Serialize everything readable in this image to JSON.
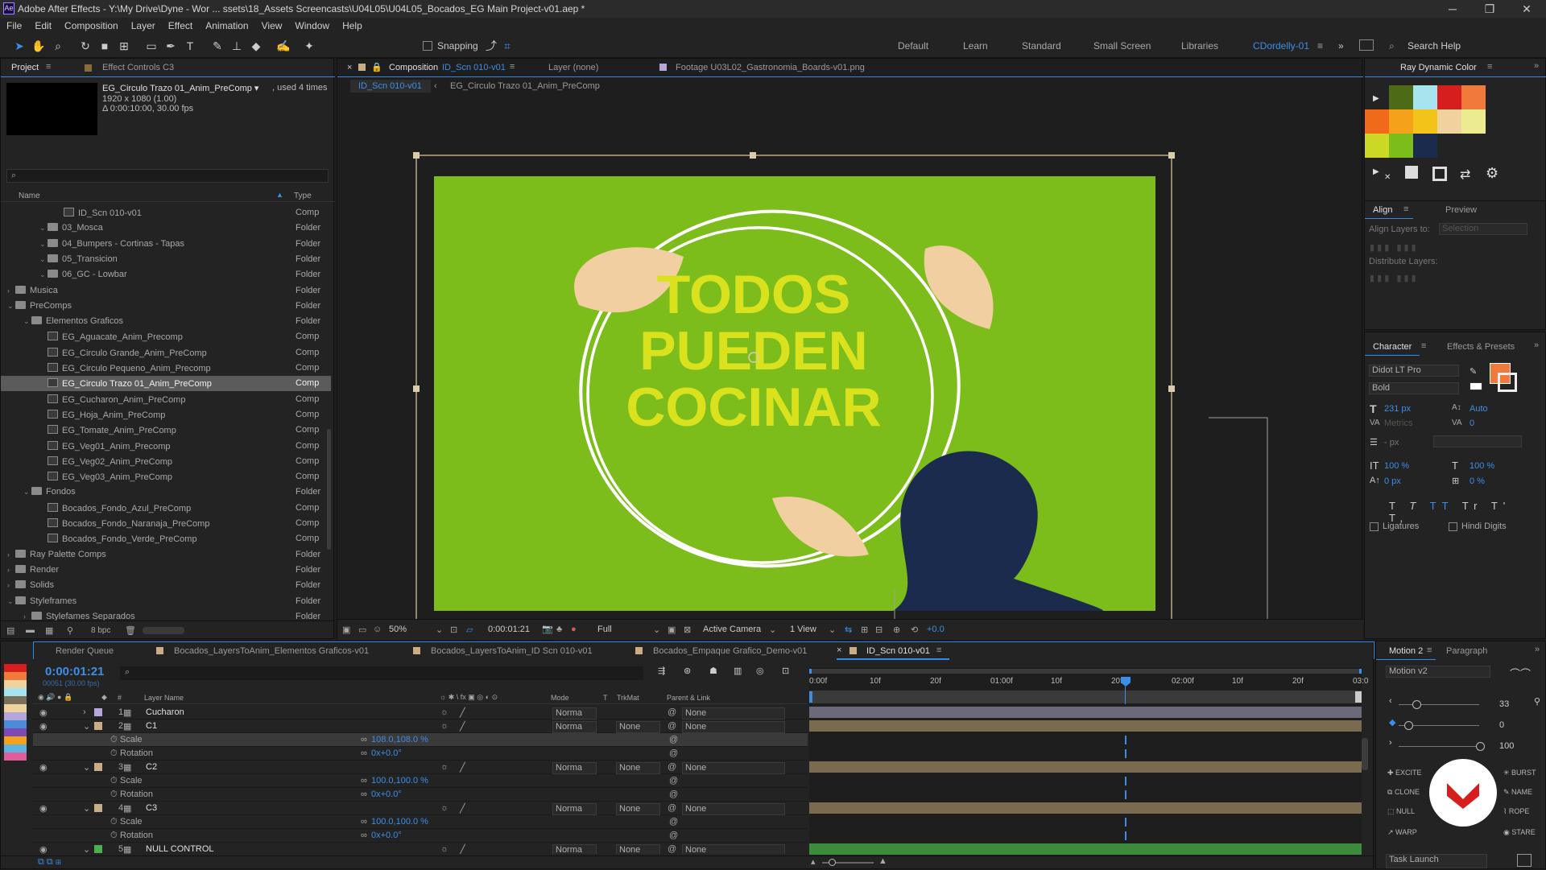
{
  "window": {
    "title": "Adobe After Effects - Y:\\My Drive\\Dyne - Wor ... ssets\\18_Assets Screencasts\\U04L05\\U04L05_Bocados_EG Main Project-v01.aep *"
  },
  "menu": [
    "File",
    "Edit",
    "Composition",
    "Layer",
    "Effect",
    "Animation",
    "View",
    "Window",
    "Help"
  ],
  "toolbar": {
    "snapping": "Snapping",
    "workspaces": [
      "Default",
      "Learn",
      "Standard",
      "Small Screen",
      "Libraries",
      "CDordelly-01"
    ],
    "search_help": "Search Help"
  },
  "project": {
    "tab": "Project",
    "tab2": "Effect Controls C3",
    "item_name": "EG_Circulo Trazo 01_Anim_PreComp ▾",
    "used": ", used 4 times",
    "info1": "1920 x 1080 (1.00)",
    "info2": "Δ 0:00:10:00, 30.00 fps",
    "col_name": "Name",
    "col_type": "Type",
    "bpc": "8 bpc",
    "rows": [
      {
        "name": "ID_Scn 010-v01",
        "type": "Comp",
        "indent": 3,
        "kind": "comp",
        "tri": ""
      },
      {
        "name": "03_Mosca",
        "type": "Folder",
        "indent": 2,
        "kind": "folder",
        "tri": "v"
      },
      {
        "name": "04_Bumpers - Cortinas - Tapas",
        "type": "Folder",
        "indent": 2,
        "kind": "folder",
        "tri": "v"
      },
      {
        "name": "05_Transicion",
        "type": "Folder",
        "indent": 2,
        "kind": "folder",
        "tri": "v"
      },
      {
        "name": "06_GC - Lowbar",
        "type": "Folder",
        "indent": 2,
        "kind": "folder",
        "tri": "v"
      },
      {
        "name": "Musica",
        "type": "Folder",
        "indent": 0,
        "kind": "folder",
        "tri": ">"
      },
      {
        "name": "PreComps",
        "type": "Folder",
        "indent": 0,
        "kind": "folder",
        "tri": "v"
      },
      {
        "name": "Elementos Graficos",
        "type": "Folder",
        "indent": 1,
        "kind": "folder",
        "tri": "v"
      },
      {
        "name": "EG_Aguacate_Anim_Precomp",
        "type": "Comp",
        "indent": 2,
        "kind": "comp",
        "tri": ""
      },
      {
        "name": "EG_Circulo Grande_Anim_PreComp",
        "type": "Comp",
        "indent": 2,
        "kind": "comp",
        "tri": ""
      },
      {
        "name": "EG_Circulo Pequeno_Anim_Precomp",
        "type": "Comp",
        "indent": 2,
        "kind": "comp",
        "tri": ""
      },
      {
        "name": "EG_Circulo Trazo 01_Anim_PreComp",
        "type": "Comp",
        "indent": 2,
        "kind": "comp",
        "tri": "",
        "sel": true
      },
      {
        "name": "EG_Cucharon_Anim_PreComp",
        "type": "Comp",
        "indent": 2,
        "kind": "comp",
        "tri": ""
      },
      {
        "name": "EG_Hoja_Anim_PreComp",
        "type": "Comp",
        "indent": 2,
        "kind": "comp",
        "tri": ""
      },
      {
        "name": "EG_Tomate_Anim_PreComp",
        "type": "Comp",
        "indent": 2,
        "kind": "comp",
        "tri": ""
      },
      {
        "name": "EG_Veg01_Anim_Precomp",
        "type": "Comp",
        "indent": 2,
        "kind": "comp",
        "tri": ""
      },
      {
        "name": "EG_Veg02_Anim_PreComp",
        "type": "Comp",
        "indent": 2,
        "kind": "comp",
        "tri": ""
      },
      {
        "name": "EG_Veg03_Anim_PreComp",
        "type": "Comp",
        "indent": 2,
        "kind": "comp",
        "tri": ""
      },
      {
        "name": "Fondos",
        "type": "Folder",
        "indent": 1,
        "kind": "folder",
        "tri": "v"
      },
      {
        "name": "Bocados_Fondo_Azul_PreComp",
        "type": "Comp",
        "indent": 2,
        "kind": "comp",
        "tri": ""
      },
      {
        "name": "Bocados_Fondo_Naranaja_PreComp",
        "type": "Comp",
        "indent": 2,
        "kind": "comp",
        "tri": ""
      },
      {
        "name": "Bocados_Fondo_Verde_PreComp",
        "type": "Comp",
        "indent": 2,
        "kind": "comp",
        "tri": ""
      },
      {
        "name": "Ray Palette Comps",
        "type": "Folder",
        "indent": 0,
        "kind": "folder",
        "tri": ">"
      },
      {
        "name": "Render",
        "type": "Folder",
        "indent": 0,
        "kind": "folder",
        "tri": ">"
      },
      {
        "name": "Solids",
        "type": "Folder",
        "indent": 0,
        "kind": "folder",
        "tri": ">"
      },
      {
        "name": "Styleframes",
        "type": "Folder",
        "indent": 0,
        "kind": "folder",
        "tri": "v"
      },
      {
        "name": "Stylefames Separados",
        "type": "Folder",
        "indent": 1,
        "kind": "folder",
        "tri": ">"
      }
    ]
  },
  "viewer": {
    "tab_comp_prefix": "Composition ",
    "tab_comp_name": "ID_Scn 010-v01",
    "tab_layer": "Layer (none)",
    "tab_footage": "Footage  U03L02_Gastronomia_Boards-v01.png",
    "crumb1": "ID_Scn 010-v01",
    "crumb2": "EG_Circulo Trazo 01_Anim_PreComp",
    "headline": [
      "TODOS",
      "PUEDEN",
      "COCINAR"
    ],
    "zoom": "50%",
    "timecode": "0:00:01:21",
    "resolution": "Full",
    "camera": "Active Camera",
    "views": "1 View",
    "exposure": "+0.0",
    "bg_color": "#7cbd1c",
    "text_color": "#d9e21c",
    "leaf_color": "#f1cfa0",
    "spoon_color": "#1a2b4e"
  },
  "timeline": {
    "tabs": [
      "Render Queue",
      "Bocados_LayersToAnim_Elementos Graficos-v01",
      "Bocados_LayersToAnim_ID Scn 010-v01",
      "Bocados_Empaque Grafico_Demo-v01",
      "ID_Scn 010-v01"
    ],
    "timecode": "0:00:01:21",
    "frames": "00051 (30.00 fps)",
    "headers": {
      "num": "#",
      "layer": "Layer Name",
      "mode": "Mode",
      "t": "T",
      "trkmat": "TrkMat",
      "parent": "Parent & Link"
    },
    "ruler": [
      "0:00f",
      "10f",
      "20f",
      "01:00f",
      "10f",
      "20f",
      "02:00f",
      "10f",
      "20f",
      "03:0"
    ],
    "rows": [
      {
        "type": "layer",
        "num": "1",
        "name": "Cucharon",
        "mode": "Norma",
        "trk": "",
        "parent": "None",
        "color": "#b7a6d9"
      },
      {
        "type": "layer",
        "num": "2",
        "name": "C1",
        "mode": "Norma",
        "trk": "None",
        "parent": "None",
        "color": "#c9ad86"
      },
      {
        "type": "prop",
        "name": "Scale",
        "value": "108.0,108.0 %",
        "sel": true
      },
      {
        "type": "prop",
        "name": "Rotation",
        "value": "0x+0.0°"
      },
      {
        "type": "layer",
        "num": "3",
        "name": "C2",
        "mode": "Norma",
        "trk": "None",
        "parent": "None",
        "color": "#c9ad86"
      },
      {
        "type": "prop",
        "name": "Scale",
        "value": "100.0,100.0 %"
      },
      {
        "type": "prop",
        "name": "Rotation",
        "value": "0x+0.0°"
      },
      {
        "type": "layer",
        "num": "4",
        "name": "C3",
        "mode": "Norma",
        "trk": "None",
        "parent": "None",
        "color": "#c9ad86"
      },
      {
        "type": "prop",
        "name": "Scale",
        "value": "100.0,100.0 %"
      },
      {
        "type": "prop",
        "name": "Rotation",
        "value": "0x+0.0°"
      },
      {
        "type": "layer",
        "num": "5",
        "name": "NULL CONTROL",
        "mode": "Norma",
        "trk": "None",
        "parent": "None",
        "color": "#4caf50"
      }
    ]
  },
  "ray": {
    "tab": "Ray Dynamic Color",
    "swatches": [
      "#4d6b16",
      "#a6e4f0",
      "#d61e1e",
      "#f07a3c",
      "#ef6b1a",
      "#f5a21a",
      "#f2c41a",
      "#efd29e",
      "#eceb92",
      "#cbd926",
      "#7cbd1c",
      "#1a2b4e"
    ]
  },
  "align": {
    "tab": "Align",
    "tab2": "Preview",
    "align_to": "Align Layers to:",
    "align_to_val": "Selection",
    "distribute": "Distribute Layers:"
  },
  "character": {
    "tab": "Character",
    "tab2": "Effects & Presets",
    "font": "Didot LT Pro",
    "style": "Bold",
    "size": "231 px",
    "leading": "Auto",
    "kerning": "Metrics",
    "tracking": "0",
    "stroke": "- px",
    "vscale": "100 %",
    "hscale": "100 %",
    "baseline": "0 px",
    "tsume": "0 %",
    "ligatures": "Ligatures",
    "hindi": "Hindi Digits"
  },
  "motion": {
    "tab": "Motion 2",
    "tab2": "Paragraph",
    "preset": "Motion v2",
    "v1": "33",
    "v2": "0",
    "v3": "100",
    "buttons": [
      "EXCITE",
      "BURST",
      "CLONE",
      "NAME",
      "NULL",
      "ROPE",
      "WARP",
      "STARE"
    ],
    "task": "Task Launch"
  },
  "colors": {
    "accent": "#2d8ceb",
    "panel": "#232323",
    "bg": "#1d1d1d"
  }
}
